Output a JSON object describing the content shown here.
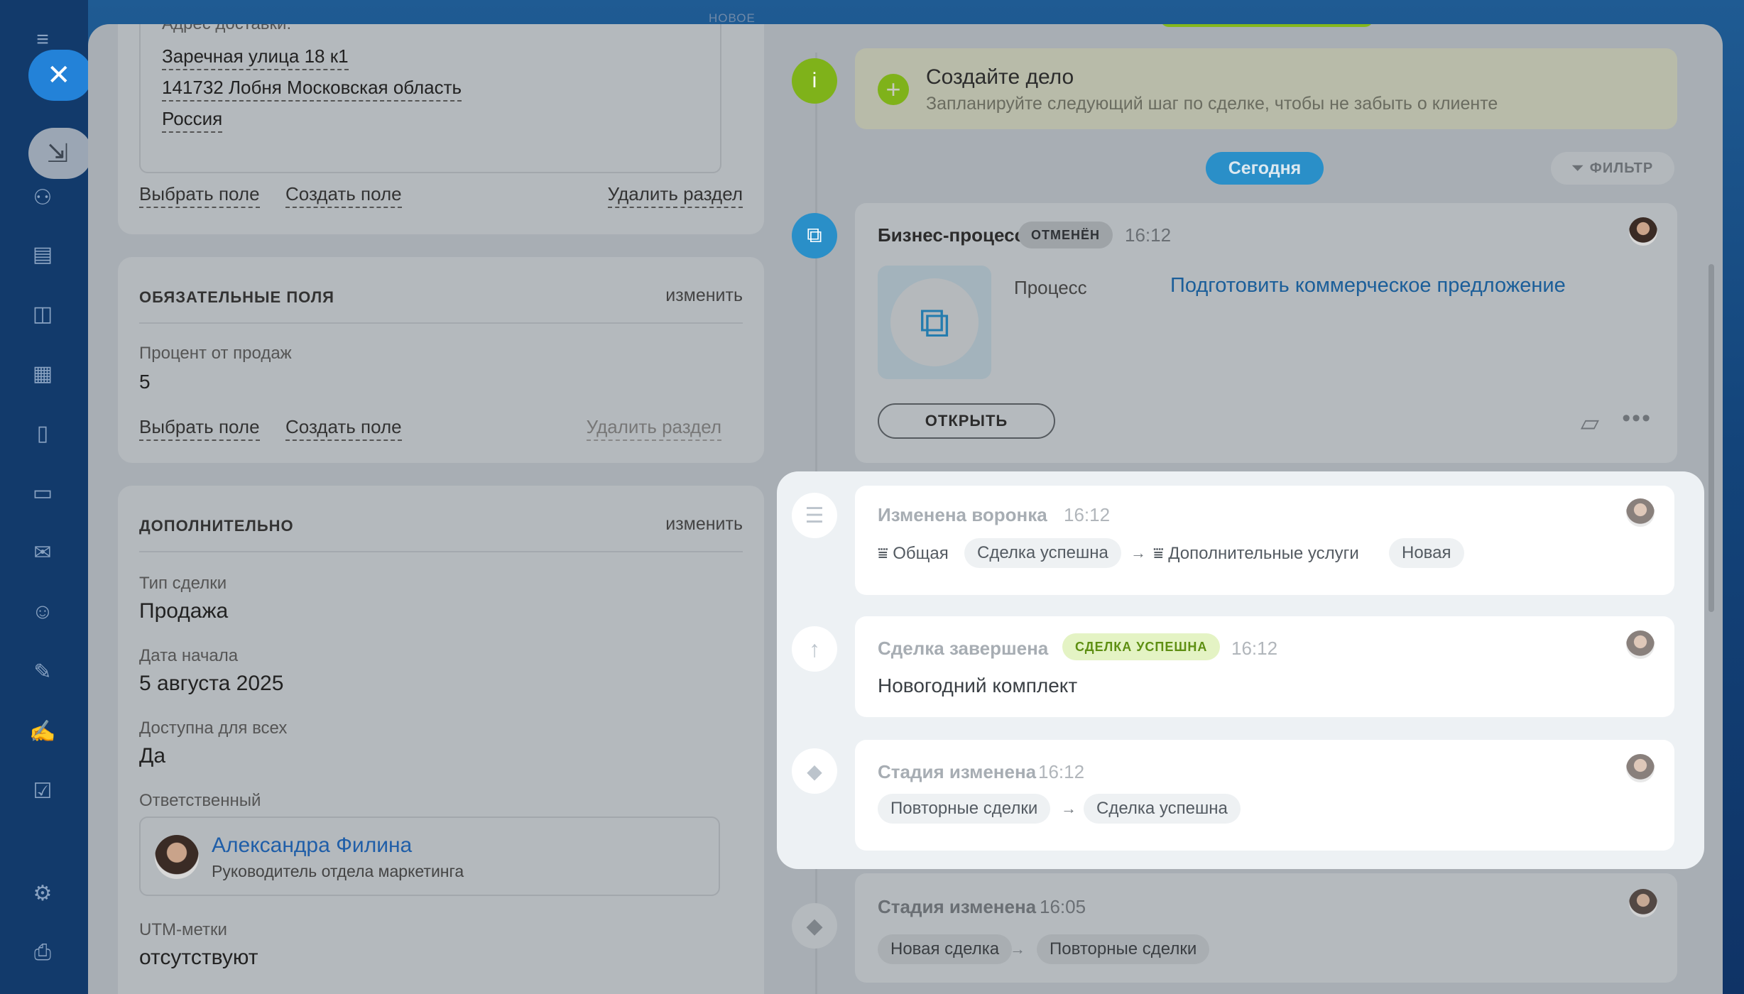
{
  "top_label": "НОВОЕ",
  "address": {
    "label": "Адрес доставки:",
    "line1": "Заречная улица 18 к1",
    "line2": "141732 Лобня Московская область",
    "line3": "Россия"
  },
  "section_actions": {
    "select_field": "Выбрать поле",
    "create_field": "Создать поле",
    "delete_section": "Удалить раздел"
  },
  "required": {
    "title": "ОБЯЗАТЕЛЬНЫЕ ПОЛЯ",
    "edit": "изменить",
    "percent_label": "Процент от продаж",
    "percent_value": "5"
  },
  "additional": {
    "title": "ДОПОЛНИТЕЛЬНО",
    "edit": "изменить",
    "deal_type_label": "Тип сделки",
    "deal_type_value": "Продажа",
    "start_date_label": "Дата начала",
    "start_date_value": "5 августа 2025",
    "public_label": "Доступна для всех",
    "public_value": "Да",
    "responsible_label": "Ответственный",
    "responsible_name": "Александра Филина",
    "responsible_position": "Руководитель отдела маркетинга",
    "utm_label": "UTM-метки",
    "utm_value": "отсутствуют"
  },
  "timeline": {
    "create_task_title": "Создайте дело",
    "create_task_hint": "Запланируйте следующий шаг по сделке, чтобы не забыть о клиенте",
    "today": "Сегодня",
    "filter": "ФИЛЬТР",
    "bp": {
      "title": "Бизнес-процесс",
      "badge": "ОТМЕНЁН",
      "time": "16:12",
      "process_label": "Процесс",
      "process_link": "Подготовить коммерческое предложение",
      "open_button": "ОТКРЫТЬ"
    },
    "funnel": {
      "title": "Изменена воронка",
      "time": "16:12",
      "from_funnel": "Общая",
      "from_stage": "Сделка успешна",
      "to_funnel": "Дополнительные услуги",
      "to_stage": "Новая"
    },
    "closed": {
      "title": "Сделка завершена",
      "badge": "СДЕЛКА УСПЕШНА",
      "time": "16:12",
      "product": "Новогодний комплект"
    },
    "stage1": {
      "title": "Стадия изменена",
      "time": "16:12",
      "from": "Повторные сделки",
      "to": "Сделка успешна"
    },
    "stage2": {
      "title": "Стадия изменена",
      "time": "16:05",
      "from": "Новая сделка",
      "to": "Повторные сделки"
    }
  },
  "colors": {
    "accent_blue": "#2382d8",
    "today_pill": "#2a9fd6",
    "success_badge_bg": "#e4f3c4",
    "success_badge_text": "#5e8f12",
    "info_green": "#7fb21a"
  }
}
